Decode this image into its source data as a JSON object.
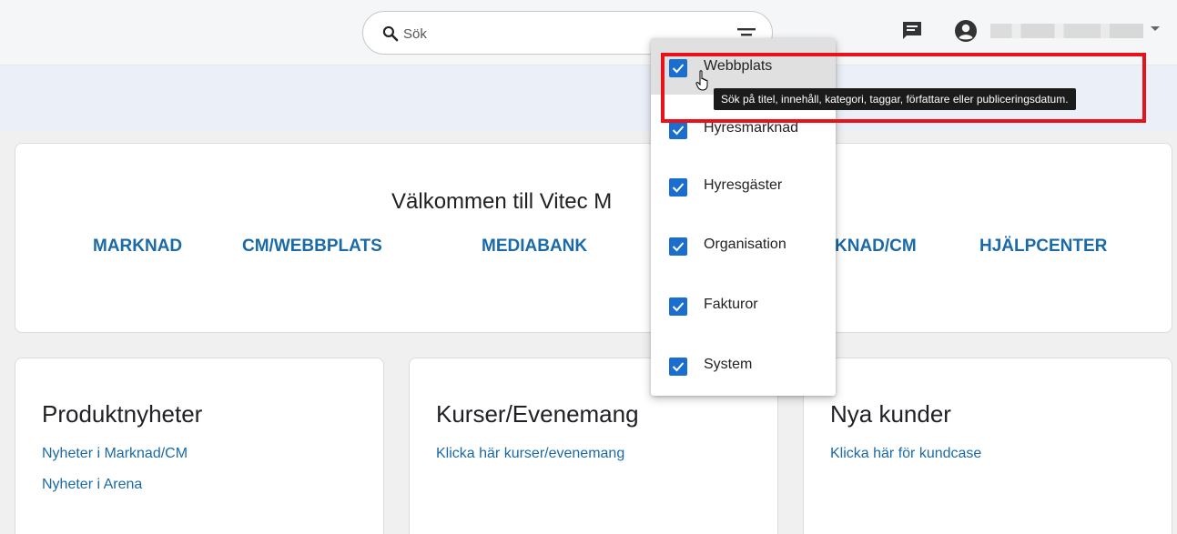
{
  "search": {
    "placeholder": "Sök"
  },
  "header": {
    "chat_icon": "chat-icon",
    "avatar_icon": "account-circle-icon"
  },
  "welcome": {
    "title": "Välkommen till Vitec M",
    "links": [
      "MARKNAD",
      "CM/WEBBPLATS",
      "MEDIABANK",
      "KNAD/CM",
      "HJÄLPCENTER"
    ]
  },
  "cards": [
    {
      "title": "Produktnyheter",
      "links": [
        "Nyheter i Marknad/CM",
        "Nyheter i Arena"
      ]
    },
    {
      "title": "Kurser/Evenemang",
      "links": [
        "Klicka här kurser/evenemang"
      ]
    },
    {
      "title": "Nya kunder",
      "links": [
        "Klicka här för kundcase"
      ]
    }
  ],
  "filter_menu": {
    "items": [
      {
        "label": "Webbplats",
        "checked": true
      },
      {
        "label": "Hyresmarknad",
        "checked": true
      },
      {
        "label": "Hyresgäster",
        "checked": true
      },
      {
        "label": "Organisation",
        "checked": true
      },
      {
        "label": "Fakturor",
        "checked": true
      },
      {
        "label": "System",
        "checked": true
      }
    ]
  },
  "tooltip": {
    "text": "Sök på titel, innehåll, kategori, taggar, författare eller publiceringsdatum."
  },
  "colors": {
    "link": "#1a6aa7",
    "checkbox": "#1a6ed0",
    "highlight": "#e8121b",
    "banner": "#eaeff8"
  }
}
